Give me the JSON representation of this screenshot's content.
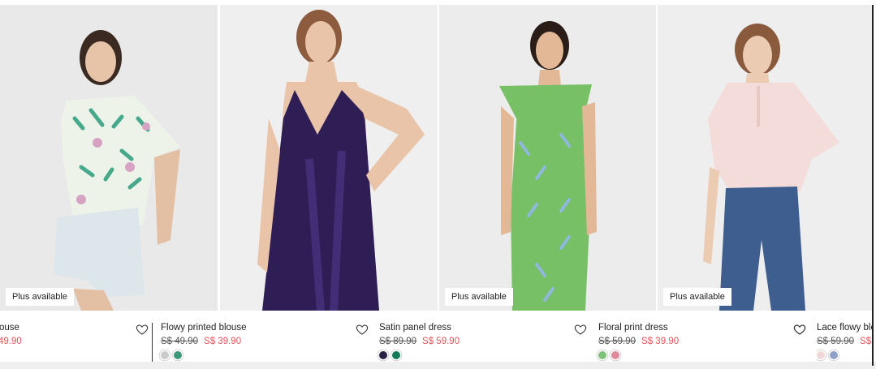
{
  "products": [
    {
      "name": "ouse",
      "old_price": "",
      "new_price": "49.90",
      "badge": "Plus available",
      "swatches": [],
      "colors": {
        "bg": "#e9e9e9",
        "garment": "#eef3ea",
        "accent": "#46a98b",
        "pants": "#dde6ea"
      }
    },
    {
      "name": "Flowy printed blouse",
      "old_price": "S$ 49.90",
      "new_price": "S$ 39.90",
      "badge": "",
      "swatches": [
        "#c9ccc9",
        "#3d9a78"
      ],
      "colors": {
        "bg": "#efefef",
        "garment": "#2e1e55",
        "accent": "#4b3586",
        "pants": ""
      }
    },
    {
      "name": "Satin panel dress",
      "old_price": "S$ 89.90",
      "new_price": "S$ 59.90",
      "badge": "Plus available",
      "swatches": [
        "#2a2146",
        "#137a55"
      ],
      "colors": {
        "bg": "#ececec",
        "garment": "#77c066",
        "accent": "#8fb7e0",
        "pants": ""
      }
    },
    {
      "name": "Floral print dress",
      "old_price": "S$ 59.90",
      "new_price": "S$ 39.90",
      "badge": "Plus available",
      "swatches": [
        "#7dc27a",
        "#e08a9c"
      ],
      "colors": {
        "bg": "#eeeeee",
        "garment": "#f3dcd9",
        "accent": "#e7c9c4",
        "pants": "#3d5e8f"
      }
    },
    {
      "name": "Lace flowy blo",
      "old_price": "S$ 59.90",
      "new_price": "S$ 4",
      "badge": "",
      "swatches": [
        "#f0d8d8",
        "#8ea0c6"
      ],
      "colors": {}
    }
  ]
}
